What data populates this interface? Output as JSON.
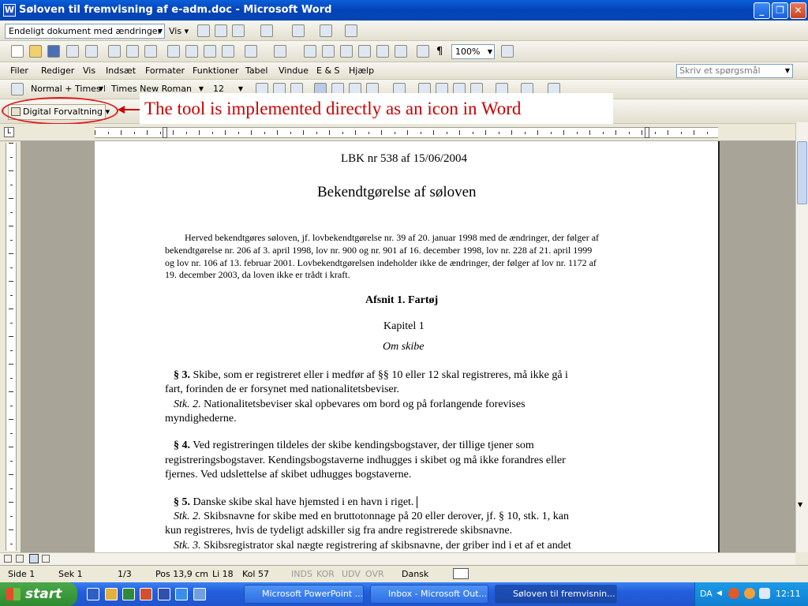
{
  "window": {
    "title": "Søloven til fremvisning af e-adm.doc - Microsoft Word",
    "app_icon": "W",
    "controls": {
      "minimize": "_",
      "maximize": "❐",
      "close": "✕"
    }
  },
  "toolbar1": {
    "mode_select": "Endeligt dokument med ændringer",
    "view_label": "Vis"
  },
  "toolbar2": {
    "zoom": "100%"
  },
  "menus": [
    "Filer",
    "Rediger",
    "Vis",
    "Indsæt",
    "Formater",
    "Funktioner",
    "Tabel",
    "Vindue",
    "E & S",
    "Hjælp"
  ],
  "ask_placeholder": "Skriv et spørgsmål",
  "format_bar": {
    "style": "Normal + Times N",
    "font": "Times New Roman",
    "size": "12"
  },
  "digital_button": "Digital Forvaltning",
  "annotation": "The tool is implemented directly as an icon in Word",
  "document": {
    "header": "LBK nr 538 af 15/06/2004",
    "title": "Bekendtgørelse af søloven",
    "intro": [
      "Herved bekendtgøres søloven, jf. lovbekendtgørelse nr. 39 af 20. januar 1998 med de ændringer, der følger af",
      "bekendtgørelse nr. 206 af 3. april 1998, lov nr. 900 og nr. 901 af 16. december 1998, lov nr. 228 af 21. april 1999",
      "og lov nr. 106 af 13. februar 2001. Lovbekendtgørelsen indeholder ikke de ændringer, der følger af lov nr. 1172 af",
      "19. december 2003, da loven ikke er trådt i kraft."
    ],
    "section": "Afsnit 1. Fartøj",
    "chapter": "Kapitel 1",
    "chapter_sub": "Om skibe",
    "p3": {
      "mark": "§ 3.",
      "line1": " Skibe, som er registreret eller i medfør af §§ 10 eller 12 skal registreres, må ikke gå i",
      "line2": "fart, forinden de er forsynet med nationalitetsbeviser.",
      "stk": "Stk. 2.",
      "stk_line1": " Nationalitetsbeviser skal opbevares om bord og på forlangende forevises",
      "stk_line2": "myndighederne."
    },
    "p4": {
      "mark": "§ 4.",
      "line1": " Ved registreringen tildeles der skibe kendingsbogstaver, der tillige tjener som",
      "line2": "registreringsbogstaver. Kendingsbogstaverne indhugges i skibet og må ikke forandres eller",
      "line3": "fjernes. Ved udslettelse af skibet udhugges bogstaverne."
    },
    "p5": {
      "mark": "§ 5.",
      "line1": " Danske skibe skal have hjemsted i en havn i riget.",
      "stk2": "Stk. 2.",
      "stk2_line1": " Skibsnavne for skibe med en bruttotonnage på 20 eller derover, jf. § 10, stk. 1, kan",
      "stk2_line2": "kun registreres, hvis de tydeligt adskiller sig fra andre registrerede skibsnavne.",
      "stk3": "Stk. 3.",
      "stk3_line1": " Skibsregistrator skal nægte registrering af skibsnavne, der griber ind i et af et andet"
    }
  },
  "status": {
    "page": "Side 1",
    "section": "Sek 1",
    "pages": "1/3",
    "pos": "Pos 13,9 cm",
    "line": "Li 18",
    "col": "Kol 57",
    "rec": "INDS",
    "trk": "KOR",
    "ext": "UDV",
    "ovr": "OVR",
    "lang": "Dansk"
  },
  "taskbar": {
    "start": "start",
    "tasks": [
      "Microsoft PowerPoint ...",
      "Inbox - Microsoft Out...",
      "Søloven til fremvisnin..."
    ],
    "tray_lang": "DA",
    "clock": "12:11"
  },
  "colors": {
    "annotation": "#cc0000",
    "titlebar": "#0a5fd8",
    "taskbar": "#245edb",
    "start": "#3a9a3a"
  }
}
